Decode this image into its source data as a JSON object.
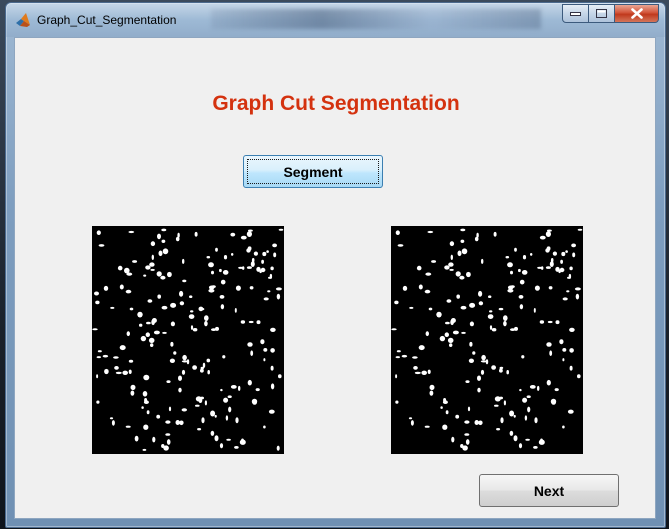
{
  "window": {
    "title": "Graph_Cut_Segmentation",
    "caption_buttons": [
      {
        "name": "minimize",
        "icon": "minimize-icon"
      },
      {
        "name": "maximize",
        "icon": "maximize-icon"
      },
      {
        "name": "close",
        "icon": "close-icon"
      }
    ],
    "app_icon": "matlab-icon"
  },
  "main": {
    "heading": "Graph Cut Segmentation",
    "heading_color": "#d4320f",
    "segment_button_label": "Segment",
    "next_button_label": "Next",
    "images": [
      {
        "name": "original-binary-image",
        "description_icon": "image-axes"
      },
      {
        "name": "segmented-binary-image",
        "description_icon": "image-axes"
      }
    ]
  },
  "colors": {
    "client_background": "#f0f0f0",
    "image_background": "#000000",
    "image_foreground": "#ffffff"
  }
}
